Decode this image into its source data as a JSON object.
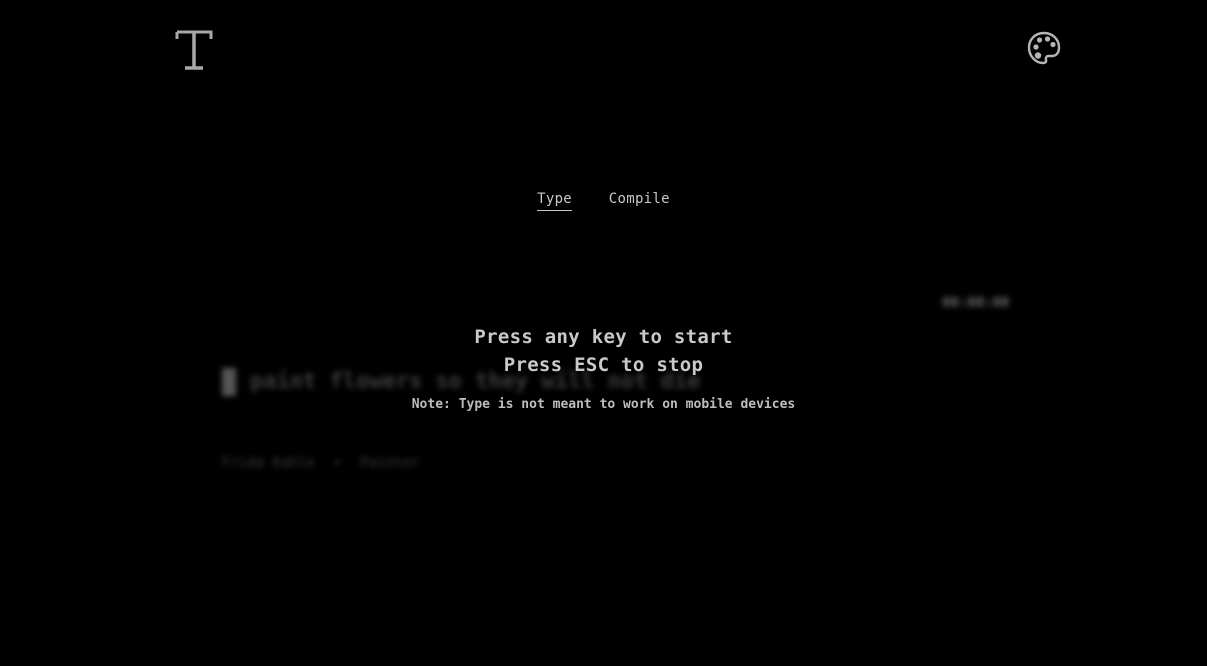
{
  "header": {
    "logo_icon": "letter-t-logo-icon",
    "theme_icon": "palette-icon"
  },
  "tabs": [
    {
      "label": "Type",
      "active": true
    },
    {
      "label": "Compile",
      "active": false
    }
  ],
  "typing_area": {
    "timer": "00:00:00",
    "quote": "paint flowers so they will not die",
    "author": "Frida Kahlo",
    "separator": "•",
    "role": "Painter"
  },
  "overlay": {
    "start_message": "Press any key to start",
    "stop_message": "Press ESC to stop",
    "note": "Note: Type is not meant to work on mobile devices"
  },
  "colors": {
    "background": "#000000",
    "text": "#c9c9c9",
    "dim_text": "#3b3b3b"
  }
}
